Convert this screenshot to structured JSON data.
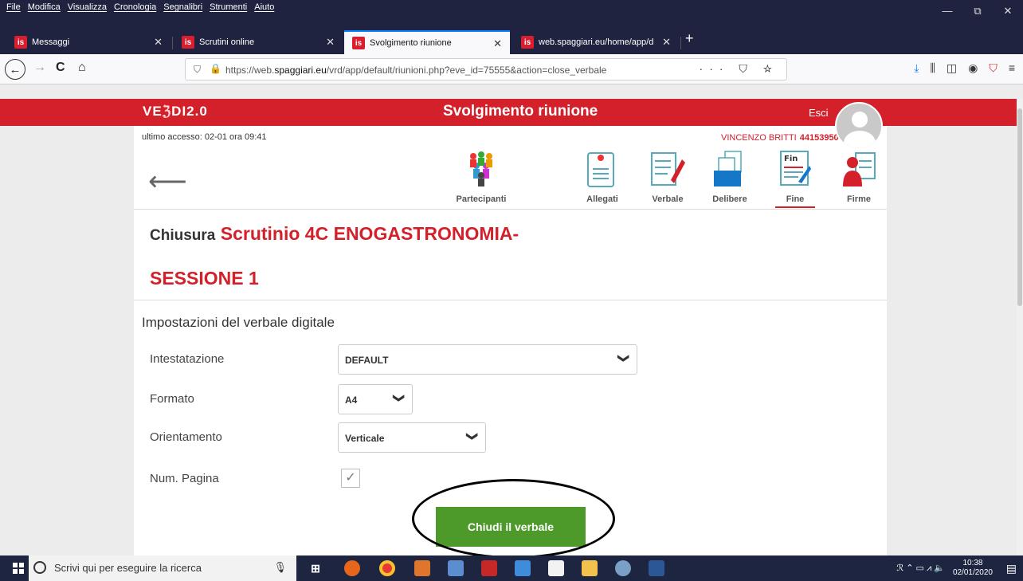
{
  "browser": {
    "menu": [
      "File",
      "Modifica",
      "Visualizza",
      "Cronologia",
      "Segnalibri",
      "Strumenti",
      "Aiuto"
    ],
    "window_controls": {
      "minimize": "—",
      "restore": "⧉",
      "close": "✕"
    },
    "tabs": [
      {
        "label": "Messaggi",
        "favicon": "is"
      },
      {
        "label": "Scrutini online",
        "favicon": "is"
      },
      {
        "label": "Svolgimento riunione",
        "favicon": "is"
      },
      {
        "label": "web.spaggiari.eu/home/app/d",
        "favicon": "is"
      }
    ],
    "tab_close": "✕",
    "new_tab": "+",
    "url_prefix": "https://web.",
    "url_domain": "spaggiari.eu",
    "url_suffix": "/vrd/app/default/riunioni.php?eve_id=75555&action=close_verbale",
    "url_actions": "··· ⛉ ☆",
    "nav": {
      "back": "←",
      "forward": "→",
      "reload": "C",
      "home": "⌂"
    },
    "toolbar_icons": [
      "⤓",
      "⫼",
      "◫",
      "◉",
      "⛉",
      "≡"
    ]
  },
  "header": {
    "logo": "VE",
    "logo_mid": "ℨ",
    "logo_end": "DI2.0",
    "title": "Svolgimento riunione",
    "logout": "Esci",
    "last_access": "ultimo accesso: 02-01 ora 09:41",
    "user_name": "VINCENZO BRITTI",
    "user_code": "44153950"
  },
  "steps": [
    {
      "label": "Partecipanti",
      "icon": "participants-icon"
    },
    {
      "label": "Allegati",
      "icon": "attachments-icon"
    },
    {
      "label": "Verbale",
      "icon": "minutes-icon"
    },
    {
      "label": "Delibere",
      "icon": "resolutions-icon"
    },
    {
      "label": "Fine",
      "icon": "finish-icon"
    },
    {
      "label": "Firme",
      "icon": "signatures-icon"
    }
  ],
  "back_arrow": "⟵",
  "page": {
    "heading_prefix": "Chiusura",
    "heading_main": "Scrutinio 4C ENOGASTRONOMIA-",
    "heading_session": "SESSIONE 1",
    "section_title": "Impostazioni del verbale digitale"
  },
  "form": {
    "intestazione_label": "Intestatazione",
    "intestazione_value": "DEFAULT",
    "formato_label": "Formato",
    "formato_value": "A4",
    "orientamento_label": "Orientamento",
    "orientamento_value": "Verticale",
    "numpagina_label": "Num. Pagina",
    "numpagina_checked": "✓",
    "chevron": "❯",
    "submit_label": "Chiudi il verbale"
  },
  "taskbar": {
    "search_placeholder": "Scrivi qui per eseguire la ricerca",
    "mic": "🎙",
    "task_view": "⊞",
    "time": "10:38",
    "date": "02/01/2020",
    "tray": "ℛ  ⌃  ▭  ⩘  🔈",
    "notifications": "▤"
  }
}
